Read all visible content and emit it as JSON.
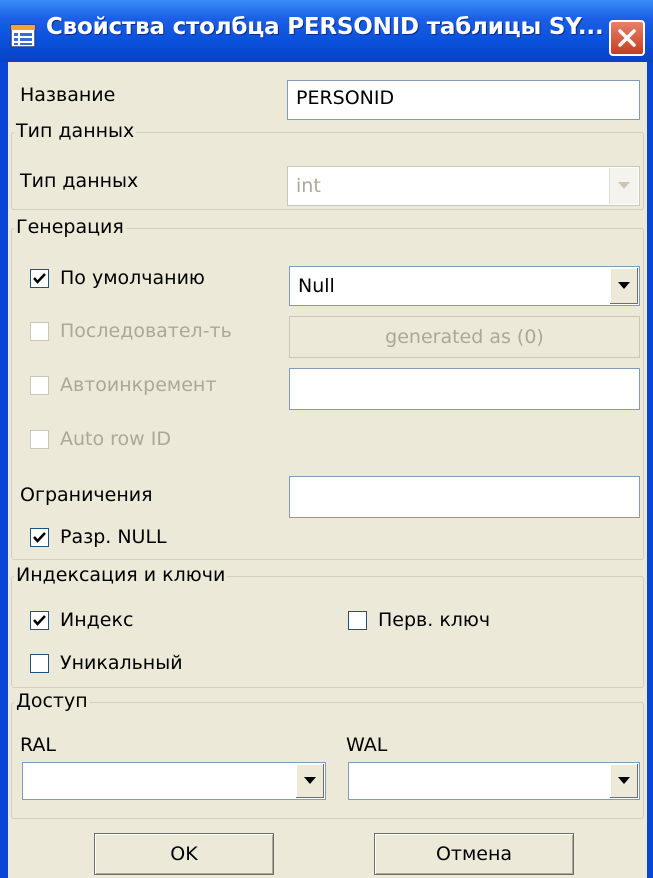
{
  "window": {
    "title": "Свойства столбца PERSONID таблицы SY...",
    "icon": "table-properties-icon",
    "close_icon": "close-icon"
  },
  "name": {
    "label": "Название",
    "value": "PERSONID"
  },
  "data_type_group": {
    "title": "Тип данных",
    "type_label": "Тип данных",
    "type_value": "int"
  },
  "generation": {
    "title": "Генерация",
    "default": {
      "label": "По умолчанию",
      "checked": true,
      "value": "Null"
    },
    "sequence": {
      "label": "Последовател-ть",
      "checked": false,
      "button": "generated as (0)"
    },
    "autoincrement": {
      "label": "Автоинкремент",
      "checked": false,
      "value": ""
    },
    "auto_row_id": {
      "label": "Auto row ID",
      "checked": false
    },
    "constraints": {
      "label": "Ограничения",
      "value": ""
    },
    "allow_null": {
      "label": "Разр. NULL",
      "checked": true
    }
  },
  "indexing": {
    "title": "Индексация и ключи",
    "index": {
      "label": "Индекс",
      "checked": true
    },
    "primary_key": {
      "label": "Перв. ключ",
      "checked": false
    },
    "unique": {
      "label": "Уникальный",
      "checked": false
    }
  },
  "access": {
    "title": "Доступ",
    "ral_label": "RAL",
    "ral_value": "",
    "wal_label": "WAL",
    "wal_value": ""
  },
  "buttons": {
    "ok": "OK",
    "cancel": "Отмена"
  }
}
